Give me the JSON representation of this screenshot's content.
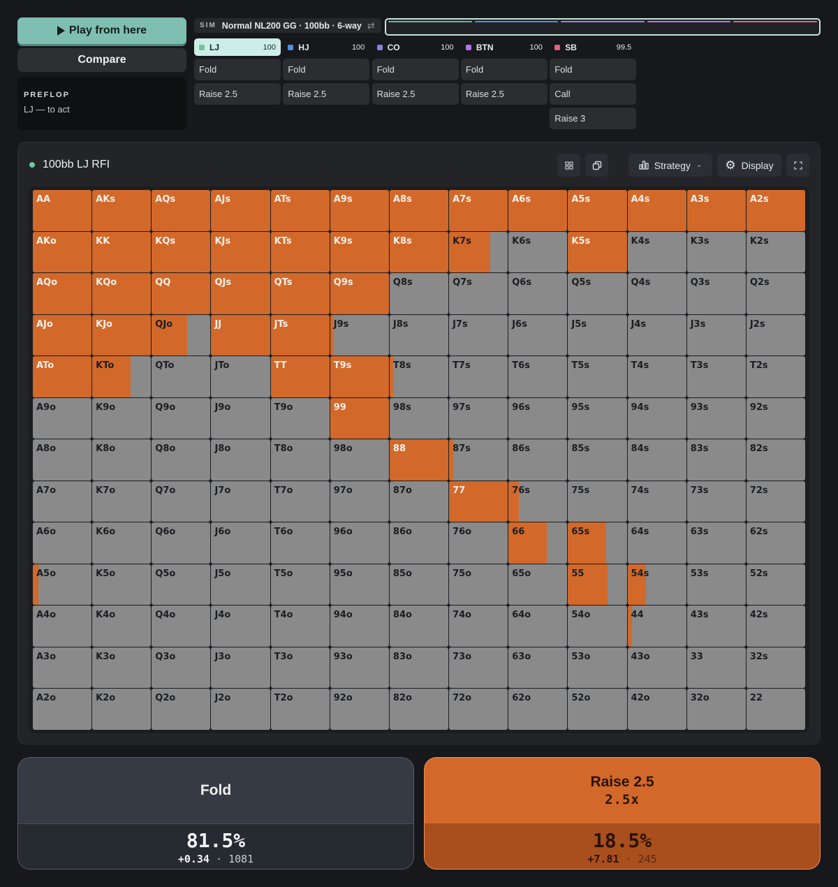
{
  "controls": {
    "play_label": "Play from here",
    "compare_label": "Compare"
  },
  "info": {
    "street": "PREFLOP",
    "status": "LJ — to act"
  },
  "sim": {
    "tag": "SIM",
    "text": "Normal NL200 GG · 100bb · 6-way"
  },
  "position_bar_colors": [
    "#6fb495",
    "#5c8fd8",
    "#9b83e6",
    "#b37ae6",
    "#d96a80"
  ],
  "players": [
    {
      "name": "LJ",
      "stack": "100",
      "color": "#6fc59c",
      "active": true,
      "actions": [
        "Fold",
        "Raise 2.5"
      ]
    },
    {
      "name": "HJ",
      "stack": "100",
      "color": "#4f8fe0",
      "active": false,
      "actions": [
        "Fold",
        "Raise 2.5"
      ]
    },
    {
      "name": "CO",
      "stack": "100",
      "color": "#8a7de6",
      "active": false,
      "actions": [
        "Fold",
        "Raise 2.5"
      ]
    },
    {
      "name": "BTN",
      "stack": "100",
      "color": "#b274e8",
      "active": false,
      "actions": [
        "Fold",
        "Raise 2.5"
      ]
    },
    {
      "name": "SB",
      "stack": "99.5",
      "color": "#e0627c",
      "active": false,
      "actions": [
        "Fold",
        "Call",
        "Raise 3"
      ]
    }
  ],
  "panel": {
    "title": "100bb LJ RFI",
    "strategy_label": "Strategy",
    "display_label": "Display"
  },
  "colors": {
    "raise": "#d2692a",
    "fold": "#8a8a8b"
  },
  "range_grid": [
    [
      [
        "AA",
        1
      ],
      [
        "AKs",
        1
      ],
      [
        "AQs",
        1
      ],
      [
        "AJs",
        1
      ],
      [
        "ATs",
        1
      ],
      [
        "A9s",
        1
      ],
      [
        "A8s",
        1
      ],
      [
        "A7s",
        1
      ],
      [
        "A6s",
        1
      ],
      [
        "A5s",
        1
      ],
      [
        "A4s",
        1
      ],
      [
        "A3s",
        1
      ],
      [
        "A2s",
        1
      ]
    ],
    [
      [
        "AKo",
        1
      ],
      [
        "KK",
        1
      ],
      [
        "KQs",
        1
      ],
      [
        "KJs",
        1
      ],
      [
        "KTs",
        1
      ],
      [
        "K9s",
        1
      ],
      [
        "K8s",
        1
      ],
      [
        "K7s",
        0.7
      ],
      [
        "K6s",
        0
      ],
      [
        "K5s",
        1
      ],
      [
        "K4s",
        0
      ],
      [
        "K3s",
        0
      ],
      [
        "K2s",
        0
      ]
    ],
    [
      [
        "AQo",
        1
      ],
      [
        "KQo",
        1
      ],
      [
        "QQ",
        1
      ],
      [
        "QJs",
        1
      ],
      [
        "QTs",
        1
      ],
      [
        "Q9s",
        1
      ],
      [
        "Q8s",
        0
      ],
      [
        "Q7s",
        0
      ],
      [
        "Q6s",
        0
      ],
      [
        "Q5s",
        0
      ],
      [
        "Q4s",
        0
      ],
      [
        "Q3s",
        0
      ],
      [
        "Q2s",
        0
      ]
    ],
    [
      [
        "AJo",
        1
      ],
      [
        "KJo",
        1
      ],
      [
        "QJo",
        0.6
      ],
      [
        "JJ",
        1
      ],
      [
        "JTs",
        1
      ],
      [
        "J9s",
        0.05
      ],
      [
        "J8s",
        0
      ],
      [
        "J7s",
        0
      ],
      [
        "J6s",
        0
      ],
      [
        "J5s",
        0
      ],
      [
        "J4s",
        0
      ],
      [
        "J3s",
        0
      ],
      [
        "J2s",
        0
      ]
    ],
    [
      [
        "ATo",
        1
      ],
      [
        "KTo",
        0.65
      ],
      [
        "QTo",
        0
      ],
      [
        "JTo",
        0
      ],
      [
        "TT",
        1
      ],
      [
        "T9s",
        1
      ],
      [
        "T8s",
        0.06
      ],
      [
        "T7s",
        0
      ],
      [
        "T6s",
        0
      ],
      [
        "T5s",
        0
      ],
      [
        "T4s",
        0
      ],
      [
        "T3s",
        0
      ],
      [
        "T2s",
        0
      ]
    ],
    [
      [
        "A9o",
        0
      ],
      [
        "K9o",
        0
      ],
      [
        "Q9o",
        0
      ],
      [
        "J9o",
        0
      ],
      [
        "T9o",
        0
      ],
      [
        "99",
        1
      ],
      [
        "98s",
        0
      ],
      [
        "97s",
        0
      ],
      [
        "96s",
        0
      ],
      [
        "95s",
        0
      ],
      [
        "94s",
        0
      ],
      [
        "93s",
        0
      ],
      [
        "92s",
        0
      ]
    ],
    [
      [
        "A8o",
        0
      ],
      [
        "K8o",
        0
      ],
      [
        "Q8o",
        0
      ],
      [
        "J8o",
        0
      ],
      [
        "T8o",
        0
      ],
      [
        "98o",
        0
      ],
      [
        "88",
        1
      ],
      [
        "87s",
        0.07
      ],
      [
        "86s",
        0
      ],
      [
        "85s",
        0
      ],
      [
        "84s",
        0
      ],
      [
        "83s",
        0
      ],
      [
        "82s",
        0
      ]
    ],
    [
      [
        "A7o",
        0
      ],
      [
        "K7o",
        0
      ],
      [
        "Q7o",
        0
      ],
      [
        "J7o",
        0
      ],
      [
        "T7o",
        0
      ],
      [
        "97o",
        0
      ],
      [
        "87o",
        0
      ],
      [
        "77",
        1
      ],
      [
        "76s",
        0.18
      ],
      [
        "75s",
        0
      ],
      [
        "74s",
        0
      ],
      [
        "73s",
        0
      ],
      [
        "72s",
        0
      ]
    ],
    [
      [
        "A6o",
        0
      ],
      [
        "K6o",
        0
      ],
      [
        "Q6o",
        0
      ],
      [
        "J6o",
        0
      ],
      [
        "T6o",
        0
      ],
      [
        "96o",
        0
      ],
      [
        "86o",
        0
      ],
      [
        "76o",
        0
      ],
      [
        "66",
        0.65
      ],
      [
        "65s",
        0.65
      ],
      [
        "64s",
        0
      ],
      [
        "63s",
        0
      ],
      [
        "62s",
        0
      ]
    ],
    [
      [
        "A5o",
        0.1
      ],
      [
        "K5o",
        0
      ],
      [
        "Q5o",
        0
      ],
      [
        "J5o",
        0
      ],
      [
        "T5o",
        0
      ],
      [
        "95o",
        0
      ],
      [
        "85o",
        0
      ],
      [
        "75o",
        0
      ],
      [
        "65o",
        0
      ],
      [
        "55",
        0.67
      ],
      [
        "54s",
        0.32
      ],
      [
        "53s",
        0
      ],
      [
        "52s",
        0
      ]
    ],
    [
      [
        "A4o",
        0
      ],
      [
        "K4o",
        0
      ],
      [
        "Q4o",
        0
      ],
      [
        "J4o",
        0
      ],
      [
        "T4o",
        0
      ],
      [
        "94o",
        0
      ],
      [
        "84o",
        0
      ],
      [
        "74o",
        0
      ],
      [
        "64o",
        0
      ],
      [
        "54o",
        0
      ],
      [
        "44",
        0.08
      ],
      [
        "43s",
        0
      ],
      [
        "42s",
        0
      ]
    ],
    [
      [
        "A3o",
        0
      ],
      [
        "K3o",
        0
      ],
      [
        "Q3o",
        0
      ],
      [
        "J3o",
        0
      ],
      [
        "T3o",
        0
      ],
      [
        "93o",
        0
      ],
      [
        "83o",
        0
      ],
      [
        "73o",
        0
      ],
      [
        "63o",
        0
      ],
      [
        "53o",
        0
      ],
      [
        "43o",
        0
      ],
      [
        "33",
        0
      ],
      [
        "32s",
        0
      ]
    ],
    [
      [
        "A2o",
        0
      ],
      [
        "K2o",
        0
      ],
      [
        "Q2o",
        0
      ],
      [
        "J2o",
        0
      ],
      [
        "T2o",
        0
      ],
      [
        "92o",
        0
      ],
      [
        "82o",
        0
      ],
      [
        "72o",
        0
      ],
      [
        "62o",
        0
      ],
      [
        "52o",
        0
      ],
      [
        "42o",
        0
      ],
      [
        "32o",
        0
      ],
      [
        "22",
        0
      ]
    ]
  ],
  "summary": {
    "fold": {
      "label": "Fold",
      "pct": "81.5%",
      "ev": "+0.34",
      "combos": "1081"
    },
    "raise": {
      "label": "Raise 2.5",
      "size": "2.5x",
      "pct": "18.5%",
      "ev": "+7.81",
      "combos": "245"
    }
  }
}
